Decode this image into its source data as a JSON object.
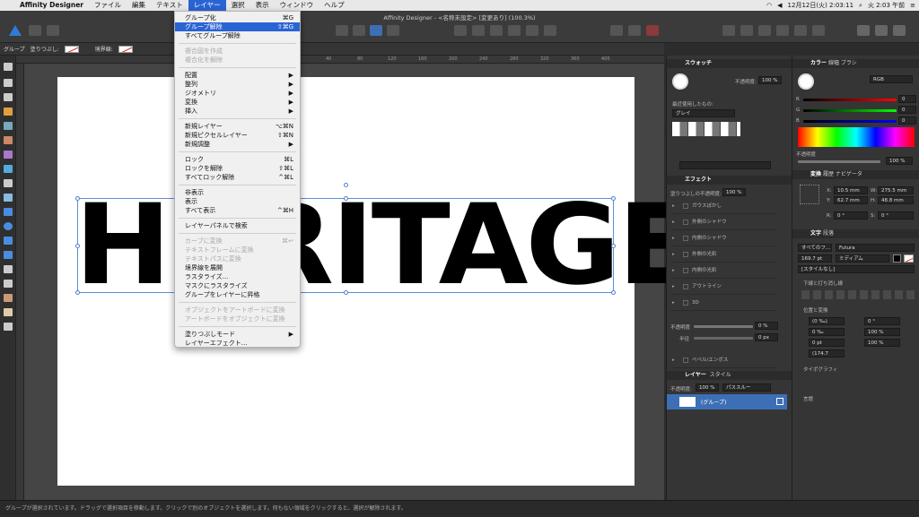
{
  "menubar": {
    "app": "Affinity Designer",
    "items": [
      "ファイル",
      "編集",
      "テキスト",
      "レイヤー",
      "選択",
      "表示",
      "ウィンドウ",
      "ヘルプ"
    ],
    "active": "レイヤー",
    "clock": "12月12日(火) 2:03:11",
    "clock2": "火 2:03 午前"
  },
  "window": {
    "title": "Affinity Designer - <名称未設定> [変更あり] (100.3%)"
  },
  "context_bar": {
    "label": "グループ",
    "fill_label": "塗りつぶし:",
    "stroke_label": "境界線:"
  },
  "ruler": {
    "ticks": [
      "40",
      "80",
      "120",
      "160",
      "200",
      "240",
      "280",
      "320",
      "360",
      "400"
    ]
  },
  "canvas": {
    "text": "HERITAGE",
    "visible_left": "HE",
    "visible_right": "ITAGE"
  },
  "layer_menu": {
    "items": [
      {
        "label": "グループ化",
        "shortcut": "⌘G",
        "state": "normal"
      },
      {
        "label": "グループ解除",
        "shortcut": "⇧⌘G",
        "state": "highlight"
      },
      {
        "label": "すべてグループ解除",
        "shortcut": "",
        "state": "normal"
      },
      {
        "label": "",
        "sep": true
      },
      {
        "label": "複合図を作成",
        "shortcut": "",
        "state": "disabled"
      },
      {
        "label": "複合化を解除",
        "shortcut": "",
        "state": "disabled"
      },
      {
        "label": "",
        "sep": true
      },
      {
        "label": "配置",
        "shortcut": "▶",
        "state": "normal"
      },
      {
        "label": "整列",
        "shortcut": "▶",
        "state": "normal"
      },
      {
        "label": "ジオメトリ",
        "shortcut": "▶",
        "state": "normal"
      },
      {
        "label": "変換",
        "shortcut": "▶",
        "state": "normal"
      },
      {
        "label": "挿入",
        "shortcut": "▶",
        "state": "normal"
      },
      {
        "label": "",
        "sep": true
      },
      {
        "label": "新規レイヤー",
        "shortcut": "⌥⌘N",
        "state": "normal"
      },
      {
        "label": "新規ピクセルレイヤー",
        "shortcut": "⇧⌘N",
        "state": "normal"
      },
      {
        "label": "新規調整",
        "shortcut": "▶",
        "state": "normal"
      },
      {
        "label": "",
        "sep": true
      },
      {
        "label": "ロック",
        "shortcut": "⌘L",
        "state": "normal"
      },
      {
        "label": "ロックを解除",
        "shortcut": "⇧⌘L",
        "state": "normal"
      },
      {
        "label": "すべてロック解除",
        "shortcut": "^⌘L",
        "state": "normal"
      },
      {
        "label": "",
        "sep": true
      },
      {
        "label": "非表示",
        "shortcut": "",
        "state": "normal"
      },
      {
        "label": "表示",
        "shortcut": "",
        "state": "normal"
      },
      {
        "label": "すべて表示",
        "shortcut": "^⌘H",
        "state": "normal"
      },
      {
        "label": "",
        "sep": true
      },
      {
        "label": "レイヤーパネルで検索",
        "shortcut": "",
        "state": "normal"
      },
      {
        "label": "",
        "sep": true
      },
      {
        "label": "カーブに変換",
        "shortcut": "⌘↩",
        "state": "disabled"
      },
      {
        "label": "テキストフレームに変換",
        "shortcut": "",
        "state": "disabled"
      },
      {
        "label": "テキストパスに変換",
        "shortcut": "",
        "state": "disabled"
      },
      {
        "label": "境界線を展開",
        "shortcut": "",
        "state": "normal"
      },
      {
        "label": "ラスタライズ...",
        "shortcut": "",
        "state": "normal"
      },
      {
        "label": "マスクにラスタライズ",
        "shortcut": "",
        "state": "normal"
      },
      {
        "label": "グループをレイヤーに昇格",
        "shortcut": "",
        "state": "normal"
      },
      {
        "label": "",
        "sep": true
      },
      {
        "label": "オブジェクトをアートボードに変換",
        "shortcut": "",
        "state": "disabled"
      },
      {
        "label": "アートボードをオブジェクトに変換",
        "shortcut": "",
        "state": "disabled"
      },
      {
        "label": "",
        "sep": true
      },
      {
        "label": "塗りつぶしモード",
        "shortcut": "▶",
        "state": "normal"
      },
      {
        "label": "レイヤーエフェクト...",
        "shortcut": "",
        "state": "normal"
      }
    ]
  },
  "swatches": {
    "tab": "スウォッチ",
    "opacity_label": "不透明度:",
    "opacity": "100 %",
    "recent": "最近使用したもの:",
    "palette": "グレイ"
  },
  "effects": {
    "tab": "エフェクト",
    "opacity_label": "塗りつぶしの不透明度:",
    "opacity": "100 %",
    "rows": [
      "ガウスぼかし",
      "外側のシャドウ",
      "内側のシャドウ",
      "外側の光彩",
      "内側の光彩",
      "アウトライン",
      "3D"
    ],
    "sub_opacity_label": "不透明度",
    "sub_opacity": "0 %",
    "radius_label": "半径",
    "radius": "0 px",
    "bevel": "ベベル/エンボス"
  },
  "layers": {
    "tab": "レイヤー",
    "tab2": "スタイル",
    "opacity_label": "不透明度:",
    "opacity": "100 %",
    "blend": "パススルー",
    "item": "(グループ)"
  },
  "color": {
    "tabs": [
      "カラー",
      "線幅",
      "ブラシ"
    ],
    "mode": "RGB",
    "r": "0",
    "g": "0",
    "b": "0",
    "opacity_label": "不透明度",
    "opacity": "100 %"
  },
  "transform": {
    "tabs": [
      "変換",
      "履歴",
      "ナビゲータ"
    ],
    "x_label": "X:",
    "x": "10.5 mm",
    "w_label": "W:",
    "w": "275.5 mm",
    "y_label": "Y:",
    "y": "62.7 mm",
    "h_label": "H:",
    "h": "48.8 mm",
    "r_label": "R:",
    "r": "0 °",
    "s_label": "S:",
    "s": "0 °"
  },
  "text_panel": {
    "tabs": [
      "文字",
      "段落"
    ],
    "family_label": "すべてのフ...",
    "font": "Futura",
    "size": "169.7 pt",
    "weight": "ミディアム",
    "style": "[スタイルなし]",
    "underline_section": "下線と打ち消し線",
    "position_section": "位置と変換",
    "kern": "(0 ‰)",
    "track": "0 ‰",
    "baseline": "0 pt",
    "leading": "(174.7",
    "skew": "0 °",
    "hscale": "100 %",
    "vscale": "100 %",
    "typo_section": "タイポグラフィ",
    "lang_section": "言語"
  },
  "statusbar": {
    "text": "グループが選択されています。ドラッグで選択項目を移動します。クリックで別のオブジェクトを選択します。何もない領域をクリックすると、選択が解除されます。"
  }
}
